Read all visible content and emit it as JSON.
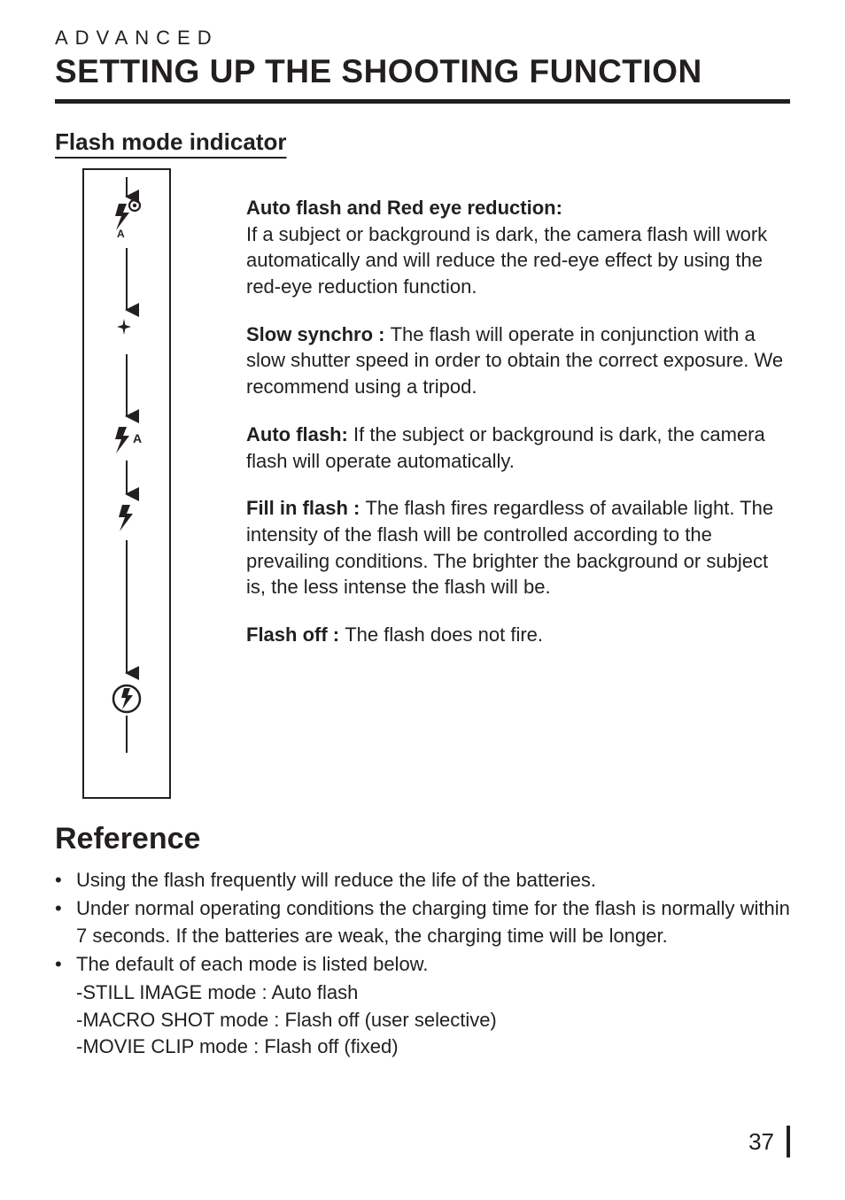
{
  "header": {
    "category": "ADVANCED",
    "title": "SETTING UP THE SHOOTING FUNCTION"
  },
  "section": {
    "subhead": "Flash mode indicator"
  },
  "modes": {
    "auto_red": {
      "label": "Auto flash and Red eye reduction:",
      "text": "If a subject or background is dark, the camera flash will work automatically and will reduce the red-eye effect by using the red-eye reduction function."
    },
    "slow": {
      "label": "Slow synchro : ",
      "text": "The flash will operate in conjunction with a slow shutter speed in order to obtain the correct exposure. We recommend using a tripod."
    },
    "auto": {
      "label": "Auto flash: ",
      "text": "If the subject or background is dark, the camera flash will operate automatically."
    },
    "fill": {
      "label": "Fill in flash : ",
      "text": "The flash fires regardless of available light. The intensity of the flash will be controlled according to the prevailing conditions. The brighter the background or subject is, the less intense the flash will be."
    },
    "off": {
      "label": "Flash off : ",
      "text": "The flash does not fire."
    }
  },
  "reference": {
    "title": "Reference",
    "items": {
      "a": "Using the flash frequently will reduce the life of the batteries.",
      "b": "Under normal operating conditions the charging time for the flash is normally within 7 seconds. If the batteries are weak, the charging time will be longer.",
      "c": "The default of each mode is listed below.",
      "c1": "-STILL IMAGE mode : Auto flash",
      "c2": "-MACRO SHOT mode : Flash off (user selective)",
      "c3": "-MOVIE CLIP mode : Flash off (fixed)"
    }
  },
  "page_number": "37"
}
